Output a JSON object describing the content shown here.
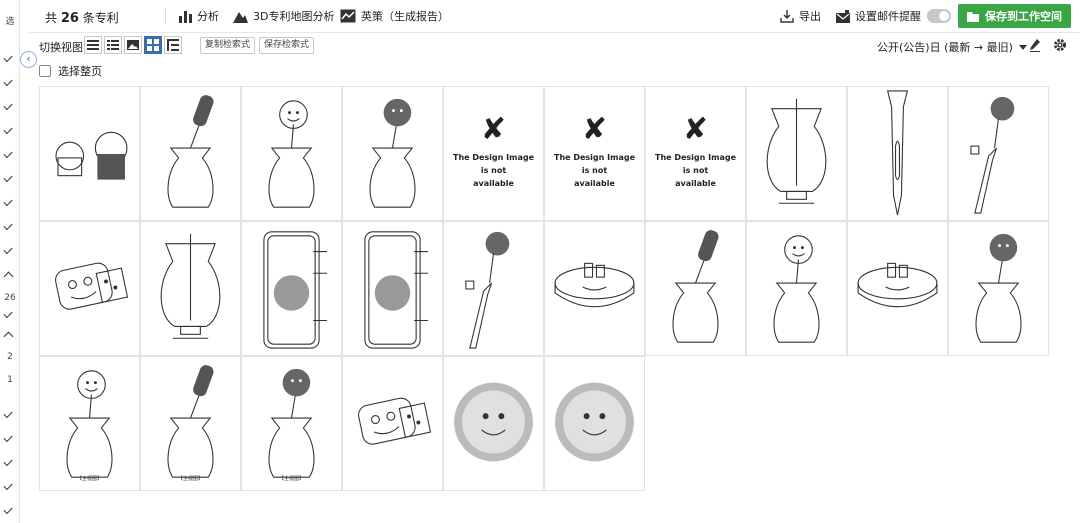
{
  "left_rail": {
    "top_label": "选",
    "numbers": [
      "26",
      "2",
      "1"
    ]
  },
  "header": {
    "total_prefix": "共",
    "total_count": "26",
    "total_suffix": "条专利",
    "analysis": "分析",
    "map_analysis": "3D专利地图分析",
    "strategy": "英策（生成报告）",
    "export": "导出",
    "email_alert": "设置邮件提醒",
    "save_workspace": "保存到工作空间",
    "accent_color": "#3aa544"
  },
  "toolbar": {
    "view_label": "切换视图",
    "copy_query": "复制检索式",
    "save_query": "保存检索式",
    "sort_label": "公开(公告)日 (最新 → 最旧)"
  },
  "select_page": "选择整页",
  "grid": {
    "cells": [
      {
        "type": "img",
        "icon": "brush-caps-drawing"
      },
      {
        "type": "img",
        "icon": "vase-brush-drawing"
      },
      {
        "type": "img",
        "icon": "vase-flower-drawing"
      },
      {
        "type": "img",
        "icon": "vase-smiley-brush-drawing"
      },
      {
        "type": "na",
        "x": "✘",
        "line1": "The Design Image",
        "line2": "is not",
        "line3": "available"
      },
      {
        "type": "na",
        "x": "✘",
        "line1": "The Design Image",
        "line2": "is not",
        "line3": "available"
      },
      {
        "type": "na",
        "x": "✘",
        "line1": "The Design Image",
        "line2": "is not",
        "line3": "available"
      },
      {
        "type": "img",
        "icon": "dispenser-drawing"
      },
      {
        "type": "img",
        "icon": "slim-holder-drawing"
      },
      {
        "type": "img",
        "icon": "handle-brush-drawing"
      },
      {
        "type": "img",
        "icon": "sponge-face-drawing"
      },
      {
        "type": "img",
        "icon": "dispenser-detail-drawing"
      },
      {
        "type": "img",
        "icon": "phone-case-drawing"
      },
      {
        "type": "img",
        "icon": "phone-case-drawing-2"
      },
      {
        "type": "img",
        "icon": "handle-brush-drawing-2"
      },
      {
        "type": "img",
        "icon": "round-base-drawing"
      },
      {
        "type": "img",
        "icon": "vase-brush-drawing-2"
      },
      {
        "type": "img",
        "icon": "vase-flower-drawing-2"
      },
      {
        "type": "img",
        "icon": "round-base-drawing-2"
      },
      {
        "type": "img",
        "icon": "vase-smiley-brush-drawing-2"
      },
      {
        "type": "img",
        "icon": "vase-flower-drawing-3",
        "caption": "【主视图】"
      },
      {
        "type": "img",
        "icon": "vase-brush-drawing-3",
        "caption": "【主视图】"
      },
      {
        "type": "img",
        "icon": "vase-smiley-brush-drawing-3",
        "caption": "【主视图】"
      },
      {
        "type": "img",
        "icon": "sponge-face-drawing-2"
      },
      {
        "type": "img",
        "icon": "round-sponge-drawing"
      },
      {
        "type": "img",
        "icon": "round-sponge-drawing-2"
      }
    ]
  }
}
